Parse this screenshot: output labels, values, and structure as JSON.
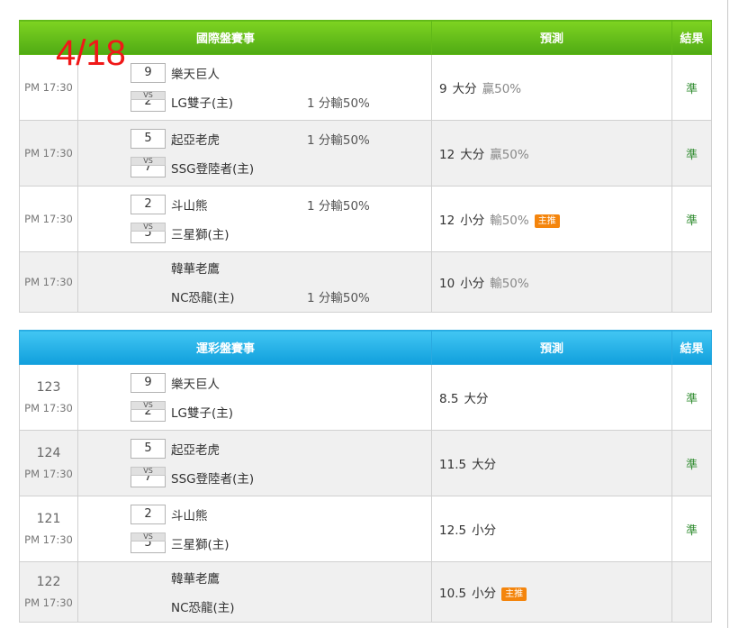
{
  "date_label": "4/18",
  "intl": {
    "header": {
      "title": "國際盤賽事",
      "predict": "預測",
      "result": "結果"
    },
    "rows": [
      {
        "time": "PM 17:30",
        "team1": "樂天巨人",
        "score1": "9",
        "team2": "LG雙子(主)",
        "score2": "2",
        "handicap": "1 分輸50%",
        "handicap_row": 2,
        "pred_num": "9",
        "pred_kind": "大分",
        "pred_stat": "贏50%",
        "badge": "",
        "result": "準"
      },
      {
        "time": "PM 17:30",
        "team1": "起亞老虎",
        "score1": "5",
        "team2": "SSG登陸者(主)",
        "score2": "7",
        "handicap": "1 分輸50%",
        "handicap_row": 1,
        "pred_num": "12",
        "pred_kind": "大分",
        "pred_stat": "贏50%",
        "badge": "",
        "result": "準"
      },
      {
        "time": "PM 17:30",
        "team1": "斗山熊",
        "score1": "2",
        "team2": "三星獅(主)",
        "score2": "5",
        "handicap": "1 分輸50%",
        "handicap_row": 1,
        "pred_num": "12",
        "pred_kind": "小分",
        "pred_stat": "輸50%",
        "badge": "主推",
        "result": "準"
      },
      {
        "time": "PM 17:30",
        "team1": "韓華老鷹",
        "score1": "",
        "team2": "NC恐龍(主)",
        "score2": "",
        "handicap": "1 分輸50%",
        "handicap_row": 2,
        "pred_num": "10",
        "pred_kind": "小分",
        "pred_stat": "輸50%",
        "badge": "",
        "result": ""
      }
    ]
  },
  "lottery": {
    "header": {
      "title": "運彩盤賽事",
      "predict": "預測",
      "result": "結果"
    },
    "rows": [
      {
        "code": "123",
        "time": "PM 17:30",
        "team1": "樂天巨人",
        "score1": "9",
        "team2": "LG雙子(主)",
        "score2": "2",
        "pred_num": "8.5",
        "pred_kind": "大分",
        "badge": "",
        "result": "準"
      },
      {
        "code": "124",
        "time": "PM 17:30",
        "team1": "起亞老虎",
        "score1": "5",
        "team2": "SSG登陸者(主)",
        "score2": "7",
        "pred_num": "11.5",
        "pred_kind": "大分",
        "badge": "",
        "result": "準"
      },
      {
        "code": "121",
        "time": "PM 17:30",
        "team1": "斗山熊",
        "score1": "2",
        "team2": "三星獅(主)",
        "score2": "5",
        "pred_num": "12.5",
        "pred_kind": "小分",
        "badge": "",
        "result": "準"
      },
      {
        "code": "122",
        "time": "PM 17:30",
        "team1": "韓華老鷹",
        "score1": "",
        "team2": "NC恐龍(主)",
        "score2": "",
        "pred_num": "10.5",
        "pred_kind": "小分",
        "badge": "主推",
        "result": ""
      }
    ]
  }
}
